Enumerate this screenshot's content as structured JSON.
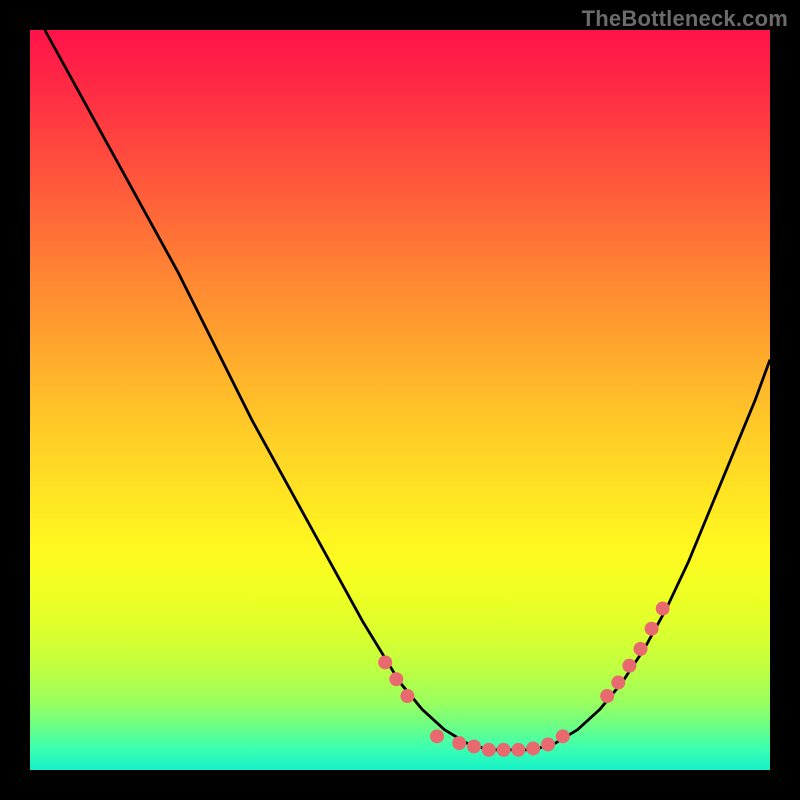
{
  "watermark": "TheBottleneck.com",
  "chart_data": {
    "type": "line",
    "title": "",
    "xlabel": "",
    "ylabel": "",
    "xlim": [
      0,
      100
    ],
    "ylim": [
      0,
      110
    ],
    "grid": false,
    "legend": false,
    "series": [
      {
        "name": "curve",
        "x": [
          2,
          5,
          10,
          15,
          20,
          25,
          30,
          35,
          40,
          45,
          50,
          53,
          56,
          59,
          62,
          65,
          68,
          71,
          74,
          77,
          80,
          83,
          86,
          89,
          92,
          95,
          98,
          100
        ],
        "y": [
          110,
          104,
          94,
          84,
          74,
          63,
          52,
          42,
          32,
          22,
          13,
          9,
          6,
          4,
          3,
          3,
          3,
          4,
          6,
          9,
          13,
          18,
          24,
          31,
          39,
          47,
          55,
          61
        ]
      }
    ],
    "points": {
      "name": "markers",
      "x": [
        48,
        49.5,
        51,
        55,
        58,
        60,
        62,
        64,
        66,
        68,
        70,
        72,
        78,
        79.5,
        81,
        82.5,
        84,
        85.5
      ],
      "y": [
        16,
        13.5,
        11,
        5,
        4,
        3.5,
        3,
        3,
        3,
        3.2,
        3.8,
        5,
        11,
        13,
        15.5,
        18,
        21,
        24
      ]
    },
    "colors": {
      "curve": "#000000",
      "points": "#e86a6f",
      "gradient_top": "#ff134a",
      "gradient_bottom": "#14f1c8"
    }
  }
}
